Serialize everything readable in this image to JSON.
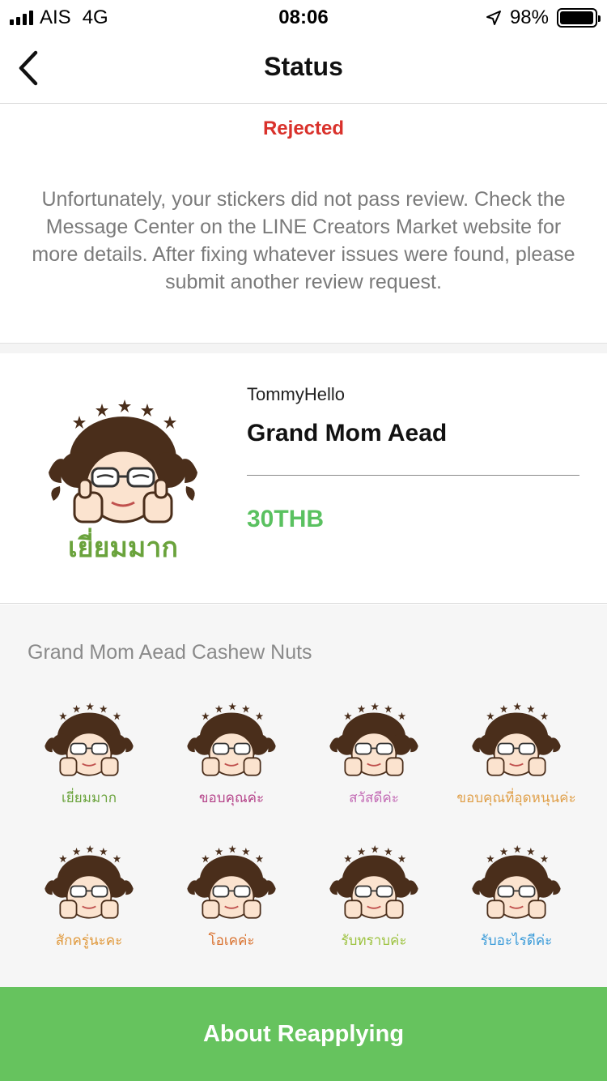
{
  "statusbar": {
    "carrier": "AIS",
    "network": "4G",
    "time": "08:06",
    "battery": "98%",
    "battery_level": 0.98
  },
  "nav": {
    "title": "Status",
    "back_icon": "chevron-left-icon"
  },
  "status": {
    "label": "Rejected",
    "label_color": "#d9312b",
    "message": "Unfortunately, your stickers did not pass review. Check the Message Center on the LINE Creators Market website for more details. After fixing whatever issues were found, please submit another review request."
  },
  "product": {
    "main_sticker_caption": "เยี่ยมมาก",
    "author": "TommyHello",
    "title": "Grand Mom Aead",
    "price": "30THB",
    "price_color": "#5ac160"
  },
  "set": {
    "title": "Grand Mom Aead Cashew Nuts",
    "stickers": [
      {
        "caption": "เยี่ยมมาก",
        "color": "#6aa33c"
      },
      {
        "caption": "ขอบคุณค่ะ",
        "color": "#b5448a"
      },
      {
        "caption": "สวัสดีค่ะ",
        "color": "#c36bb5"
      },
      {
        "caption": "ขอบคุณที่อุดหนุนค่ะ",
        "color": "#e0a04a"
      },
      {
        "caption": "สักครู่นะคะ",
        "color": "#e0983a"
      },
      {
        "caption": "โอเคค่ะ",
        "color": "#d9712e"
      },
      {
        "caption": "รับทราบค่ะ",
        "color": "#9cc23e"
      },
      {
        "caption": "รับอะไรดีค่ะ",
        "color": "#3a9bd9"
      }
    ]
  },
  "footer": {
    "button_label": "About Reapplying",
    "button_color": "#66c35e"
  }
}
